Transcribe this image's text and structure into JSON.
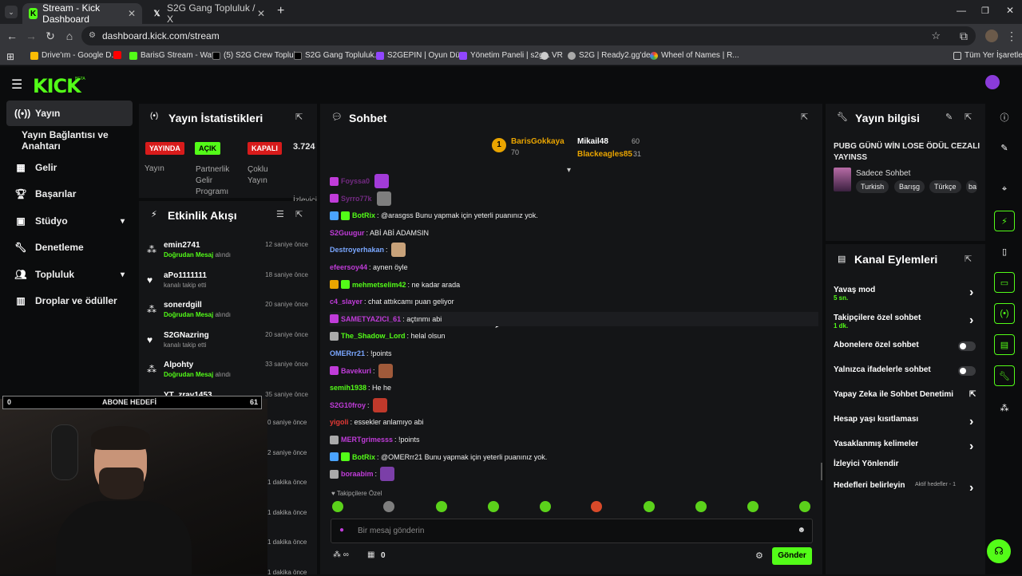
{
  "browser": {
    "tabs": [
      {
        "title": "Stream - Kick Dashboard",
        "icon": "kick-favicon"
      },
      {
        "title": "S2G Gang Topluluk / X",
        "icon": "x-favicon"
      }
    ],
    "new_tab": "+",
    "url": "dashboard.kick.com/stream",
    "bookmarks": [
      "Drive'ım - Google D...",
      "BarisG Stream - Wat...",
      "(5) S2G Crew Toplul...",
      "S2G Gang Topluluk...",
      "S2GEPIN | Oyun Dü...",
      "Yönetim Paneli | s2g...",
      "VR",
      "S2G | Ready2.gg'de...",
      "Wheel of Names | R..."
    ],
    "bookmarks_folder": "Tüm Yer İşaretleri"
  },
  "app": {
    "logo": "KICK",
    "logo_beta": "BETA",
    "accent": "#53fc18"
  },
  "sidebar": {
    "items": [
      {
        "label": "Yayın",
        "icon": "broadcast-icon"
      },
      {
        "label": "Yayın Bağlantısı ve Anahtarı",
        "icon": ""
      },
      {
        "label": "Gelir",
        "icon": "dashboard-icon"
      },
      {
        "label": "Başarılar",
        "icon": "trophy-icon"
      },
      {
        "label": "Stüdyo",
        "icon": "studio-icon"
      },
      {
        "label": "Denetleme",
        "icon": "wrench-icon"
      },
      {
        "label": "Topluluk",
        "icon": "people-icon"
      },
      {
        "label": "Droplar ve ödüller",
        "icon": "gift-icon"
      }
    ]
  },
  "stats": {
    "title": "Yayın İstatistikleri",
    "badges": [
      {
        "label": "YAYINDA",
        "caption": "Yayın"
      },
      {
        "label": "AÇIK",
        "caption": "Partnerlik Gelir Programı"
      },
      {
        "label": "KAPALI",
        "caption": "Çoklu Yayın"
      }
    ],
    "viewers": "3.724",
    "viewers_label": "İzleyici"
  },
  "activity": {
    "title": "Etkinlik Akışı",
    "events": [
      {
        "name": "emin2741",
        "pre": "",
        "highlight": "Doğrudan Mesaj",
        "post": " alındı",
        "time": "12 saniye önce"
      },
      {
        "name": "aPo1111111",
        "pre": "kanalı takip etti",
        "highlight": "",
        "post": "",
        "time": "18 saniye önce"
      },
      {
        "name": "sonerdgill",
        "pre": "",
        "highlight": "Doğrudan Mesaj",
        "post": " alındı",
        "time": "20 saniye önce"
      },
      {
        "name": "S2GNazring",
        "pre": "kanalı takip etti",
        "highlight": "",
        "post": "",
        "time": "20 saniye önce"
      },
      {
        "name": "Alpohty",
        "pre": "",
        "highlight": "Doğrudan Mesaj",
        "post": " alındı",
        "time": "33 saniye önce"
      },
      {
        "name": "YT_zrav1453",
        "pre": "kanalı takip etti",
        "highlight": "",
        "post": "",
        "time": "35 saniye önce"
      }
    ],
    "times_partial": [
      "0 saniye önce",
      "2 saniye önce",
      "1 dakika önce",
      "1 dakika önce",
      "1 dakika önce",
      "1 dakika önce"
    ]
  },
  "overlay": {
    "goal_label": "ABONE HEDEFİ",
    "goal_current": "0",
    "goal_target": "61"
  },
  "chat": {
    "title": "Sohbet",
    "leaderboard": [
      {
        "name": "BarisGokkaya",
        "points": "70",
        "rank": "1"
      },
      {
        "name": "Mikail48",
        "points": "60"
      },
      {
        "name": "Blackeagles85",
        "points": "31"
      }
    ],
    "messages": [
      {
        "user": "Foyssa0",
        "text": "",
        "color": "#c03cd9"
      },
      {
        "user": "Syrro77k",
        "text": "",
        "color": "#c03cd9"
      },
      {
        "user": "BotRix",
        "text": ": @arasgss Bunu yapmak için yeterli puanınız yok.",
        "color": "#53fc18"
      },
      {
        "user": "S2Guugur",
        "text": ": ABİ ABİ ADAMSIN",
        "color": "#c03cd9"
      },
      {
        "user": "Destroyerhakan",
        "text": ":",
        "color": "#7aa7ff"
      },
      {
        "user": "efeersoy44",
        "text": ": aynen öyle",
        "color": "#c03cd9"
      },
      {
        "user": "mehmetselim42",
        "text": ": ne kadar arada",
        "color": "#53fc18"
      },
      {
        "user": "c4_slayer",
        "text": ": chat attıkcamı puan geliyor",
        "color": "#c03cd9"
      },
      {
        "user": "SAMETYAZICI_61",
        "text": ": açtınmı abi",
        "color": "#c03cd9"
      },
      {
        "user": "The_Shadow_Lord",
        "text": ": helal olsun",
        "color": "#53fc18"
      },
      {
        "user": "OMERrr21",
        "text": ": !points",
        "color": "#7aa7ff"
      },
      {
        "user": "Bavekuri",
        "text": ":",
        "color": "#c03cd9"
      },
      {
        "user": "semih1938",
        "text": ": He he",
        "color": "#53fc18"
      },
      {
        "user": "S2G10froy",
        "text": ":",
        "color": "#c03cd9"
      },
      {
        "user": "yigoli",
        "text": ": essekler anlamıyo abi",
        "color": "#e53935"
      },
      {
        "user": "MERTgrimesss",
        "text": ": !points",
        "color": "#c03cd9"
      },
      {
        "user": "BotRix",
        "text": ": @OMERrr21 Bunu yapmak için yeterli puanınız yok.",
        "color": "#53fc18"
      },
      {
        "user": "boraabim",
        "text": ":",
        "color": "#c03cd9"
      }
    ],
    "followers_only": "Takipçilere Özel",
    "input_placeholder": "Bir mesaj gönderin",
    "points": "0",
    "send_label": "Gönder"
  },
  "stream_info": {
    "title": "Yayın bilgisi",
    "stream_title": "PUBG GÜNÜ WİN LOSE ÖDÜL CEZALI YAYINSS",
    "category": "Sadece Sohbet",
    "tags": [
      "Turkish",
      "Barışg",
      "Türkçe",
      "ba"
    ]
  },
  "channel_actions": {
    "title": "Kanal Eylemleri",
    "rows": [
      {
        "label": "Yavaş mod",
        "sub": "5 sn."
      },
      {
        "label": "Takipçilere özel sohbet",
        "sub": "1 dk."
      },
      {
        "label": "Abonelere özel sohbet",
        "sub": ""
      },
      {
        "label": "Yalnızca ifadelerle sohbet",
        "sub": ""
      },
      {
        "label": "Yapay Zeka ile Sohbet Denetimi",
        "sub": ""
      },
      {
        "label": "Hesap yaşı kısıtlaması",
        "sub": ""
      },
      {
        "label": "Yasaklanmış kelimeler",
        "sub": ""
      },
      {
        "label": "İzleyici Yönlendir",
        "sub": ""
      },
      {
        "label": "Hedefleri belirleyin",
        "sub": "Aktif hedefler - 1"
      }
    ]
  }
}
